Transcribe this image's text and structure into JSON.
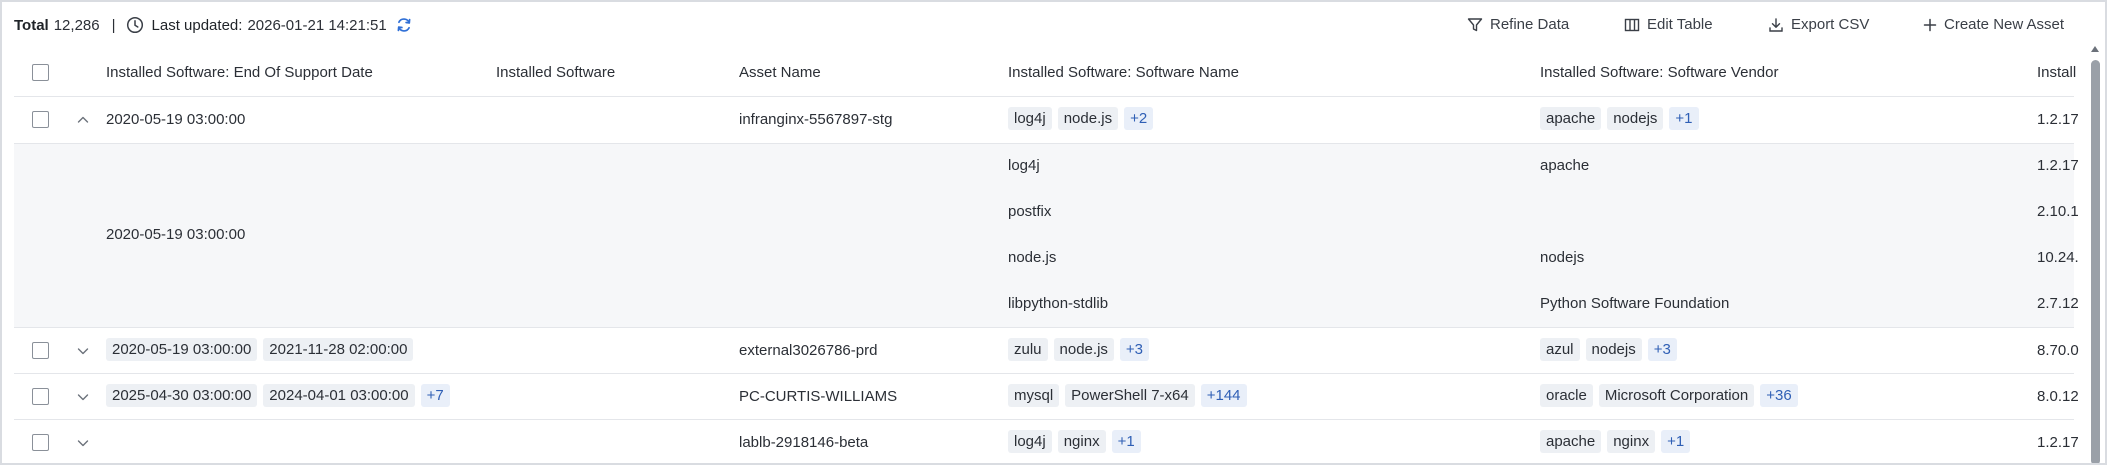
{
  "toolbar": {
    "total_label": "Total",
    "total_value": "12,286",
    "separator": "|",
    "last_updated_label": "Last updated:",
    "last_updated_value": "2026-01-21 14:21:51",
    "refine_data": "Refine Data",
    "edit_table": "Edit Table",
    "export_csv": "Export CSV",
    "create_new_asset": "Create New Asset"
  },
  "columns": {
    "eos": "Installed Software: End Of Support Date",
    "installed": "Installed Software",
    "asset": "Asset Name",
    "name": "Installed Software: Software Name",
    "vendor": "Installed Software: Software Vendor",
    "version": "Install"
  },
  "rows": [
    {
      "expanded": true,
      "eos": "2020-05-19 03:00:00",
      "asset": "infranginx-5567897-stg",
      "names": [
        "log4j",
        "node.js"
      ],
      "names_more": "+2",
      "vendors": [
        "apache",
        "nodejs"
      ],
      "vendors_more": "+1",
      "version": "1.2.17"
    },
    {
      "eos_tags": [
        "2020-05-19 03:00:00",
        "2021-11-28 02:00:00"
      ],
      "asset": "external3026786-prd",
      "names": [
        "zulu",
        "node.js"
      ],
      "names_more": "+3",
      "vendors": [
        "azul",
        "nodejs"
      ],
      "vendors_more": "+3",
      "version": "8.70.0"
    },
    {
      "eos_tags": [
        "2025-04-30 03:00:00",
        "2024-04-01 03:00:00"
      ],
      "eos_more": "+7",
      "asset": "PC-CURTIS-WILLIAMS",
      "names": [
        "mysql",
        "PowerShell 7-x64"
      ],
      "names_more": "+144",
      "vendors": [
        "oracle",
        "Microsoft Corporation"
      ],
      "vendors_more": "+36",
      "version": "8.0.12"
    },
    {
      "asset": "lablb-2918146-beta",
      "names": [
        "log4j",
        "nginx"
      ],
      "names_more": "+1",
      "vendors": [
        "apache",
        "nginx"
      ],
      "vendors_more": "+1",
      "version": "1.2.17"
    }
  ],
  "expanded_detail": {
    "eos": "2020-05-19 03:00:00",
    "items": [
      {
        "name": "log4j",
        "vendor": "apache",
        "version": "1.2.17"
      },
      {
        "name": "postfix",
        "vendor": "",
        "version": "2.10.1"
      },
      {
        "name": "node.js",
        "vendor": "nodejs",
        "version": "10.24."
      },
      {
        "name": "libpython-stdlib",
        "vendor": "Python Software Foundation",
        "version": "2.7.12"
      }
    ]
  },
  "icons": {
    "clock": "clock-icon",
    "refresh": "refresh-icon",
    "filter": "filter-icon",
    "table": "table-icon",
    "download": "download-icon",
    "plus": "plus-icon",
    "chevron_up": "chevron-up-icon",
    "chevron_down": "chevron-down-icon"
  },
  "colors": {
    "accent": "#2f5fb5",
    "refresh": "#2f6fd6",
    "tag_bg": "#edf0f4",
    "more_bg": "#e9eff9",
    "border": "#e4e6ea"
  }
}
